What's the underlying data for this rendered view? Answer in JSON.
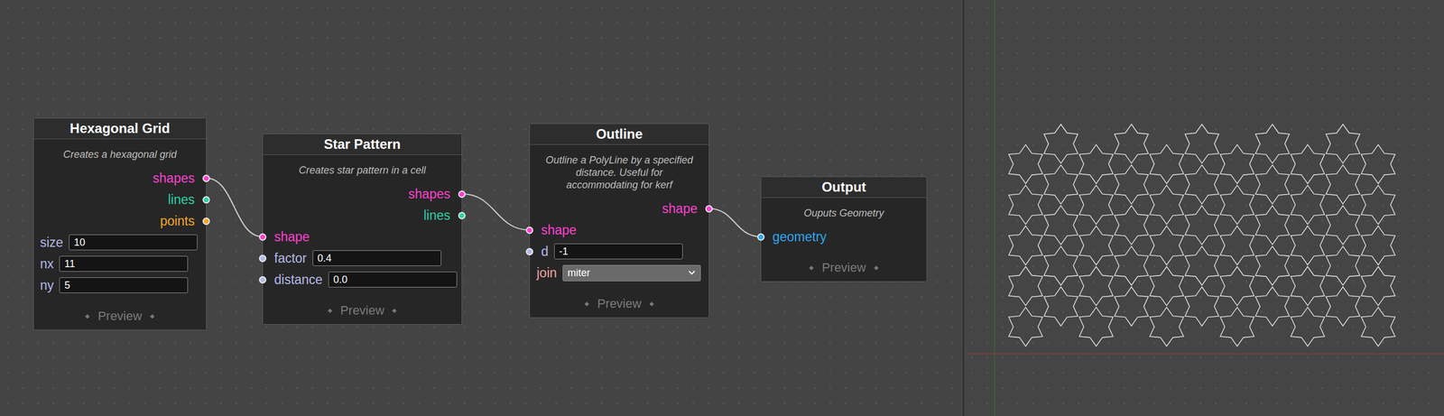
{
  "nodes": [
    {
      "title": "Hexagonal Grid",
      "description": "Creates a hexagonal grid",
      "outputs": [
        {
          "label": "shapes",
          "color": "#ff3fd2"
        },
        {
          "label": "lines",
          "color": "#2ad1a8"
        },
        {
          "label": "points",
          "color": "#f5a623"
        }
      ],
      "inputs": [
        {
          "kind": "field",
          "label": "size",
          "value": "10",
          "color": "#b4b8e8"
        },
        {
          "kind": "field",
          "label": "nx",
          "value": "11",
          "color": "#b4b8e8"
        },
        {
          "kind": "field",
          "label": "ny",
          "value": "5",
          "color": "#b4b8e8"
        }
      ],
      "preview": "Preview",
      "preview_icon": "◆"
    },
    {
      "title": "Star Pattern",
      "description": "Creates star pattern in a cell",
      "outputs": [
        {
          "label": "shapes",
          "color": "#ff3fd2"
        },
        {
          "label": "lines",
          "color": "#2ad1a8"
        }
      ],
      "inputs": [
        {
          "kind": "port",
          "label": "shape",
          "color": "#ff3fd2"
        },
        {
          "kind": "port-field",
          "label": "factor",
          "value": "0.4",
          "color": "#b4b8e8"
        },
        {
          "kind": "port-field",
          "label": "distance",
          "value": "0.0",
          "color": "#b4b8e8"
        }
      ],
      "preview": "Preview",
      "preview_icon": "◆"
    },
    {
      "title": "Outline",
      "description": "Outline a PolyLine by a specified distance. Useful for accommodating for kerf",
      "outputs": [
        {
          "label": "shape",
          "color": "#ff3fd2"
        }
      ],
      "inputs": [
        {
          "kind": "port",
          "label": "shape",
          "color": "#ff3fd2"
        },
        {
          "kind": "port-field",
          "label": "d",
          "value": "-1",
          "color": "#b4b8e8"
        },
        {
          "kind": "select",
          "label": "join",
          "value": "miter",
          "color": "#f0a3a3"
        }
      ],
      "preview": "Preview",
      "preview_icon": "◆"
    },
    {
      "title": "Output",
      "description": "Ouputs Geometry",
      "outputs": [],
      "inputs": [
        {
          "kind": "port",
          "label": "geometry",
          "color": "#2aa8f2"
        }
      ],
      "preview": "Preview",
      "preview_icon": "◆"
    }
  ],
  "connections": [
    {
      "from_node": 0,
      "from_port": 0,
      "to_node": 1,
      "to_port": 0
    },
    {
      "from_node": 1,
      "from_port": 0,
      "to_node": 2,
      "to_port": 0
    },
    {
      "from_node": 2,
      "from_port": 0,
      "to_node": 3,
      "to_port": 0
    }
  ]
}
